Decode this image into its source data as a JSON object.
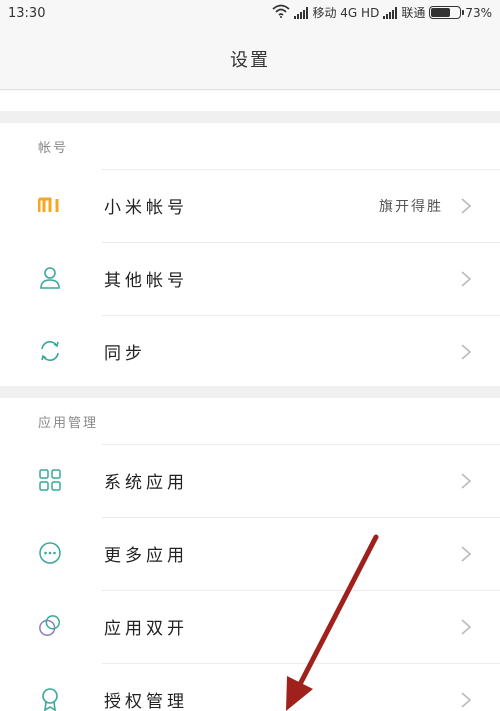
{
  "status_bar": {
    "time": "13:30",
    "carrier1": "移动 4G HD",
    "carrier2": "联通",
    "battery": "73%",
    "battery_level": 0.73
  },
  "header": {
    "title": "设置"
  },
  "sections": [
    {
      "title": "帐号",
      "items": [
        {
          "label": "小米帐号",
          "value": "旗开得胜",
          "icon": "mi-logo-icon"
        },
        {
          "label": "其他帐号",
          "icon": "person-icon"
        },
        {
          "label": "同步",
          "icon": "sync-icon"
        }
      ]
    },
    {
      "title": "应用管理",
      "items": [
        {
          "label": "系统应用",
          "icon": "grid-icon"
        },
        {
          "label": "更多应用",
          "icon": "more-dots-icon"
        },
        {
          "label": "应用双开",
          "icon": "dual-circle-icon"
        },
        {
          "label": "授权管理",
          "icon": "badge-icon"
        }
      ]
    }
  ],
  "colors": {
    "accent_teal": "#3aa89a",
    "mi_orange": "#f5a623",
    "dual_purple": "#8e7cc3",
    "annotation_arrow": "#a0201c"
  }
}
